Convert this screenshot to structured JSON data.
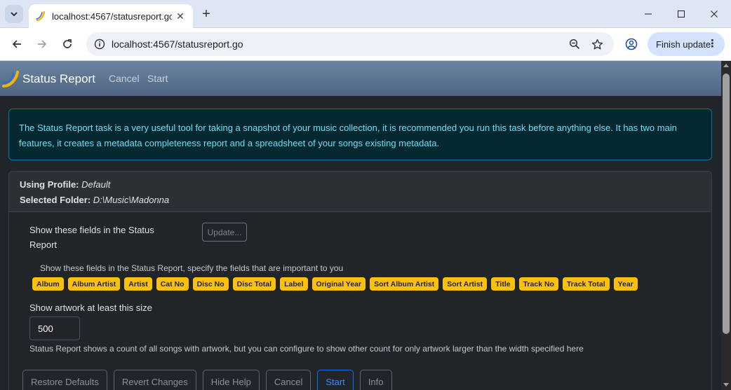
{
  "browser": {
    "tab_title": "localhost:4567/statusreport.go",
    "url": "localhost:4567/statusreport.go",
    "finish_update_label": "Finish update"
  },
  "navbar": {
    "title": "Status Report",
    "links": [
      "Cancel",
      "Start"
    ]
  },
  "alert": {
    "text": "The Status Report task is a very useful tool for taking a snapshot of your music collection, it is recommended you run this task before anything else. It has two main features, it creates a metadata completeness report and a spreadsheet of your songs existing metadata."
  },
  "profile": {
    "using_label": "Using Profile:",
    "using_value": "Default",
    "folder_label": "Selected Folder:",
    "folder_value": "D:\\Music\\Madonna"
  },
  "fields_option": {
    "label": "Show these fields in the Status Report",
    "update_button": "Update...",
    "help": "Show these fields in the Status Report, specify the fields that are important to you",
    "fields": [
      "Album",
      "Album Artist",
      "Artist",
      "Cat No",
      "Disc No",
      "Disc Total",
      "Label",
      "Original Year",
      "Sort Album Artist",
      "Sort Artist",
      "Title",
      "Track No",
      "Track Total",
      "Year"
    ]
  },
  "artwork_option": {
    "label": "Show artwork at least this size",
    "value": "500",
    "help": "Status Report shows a count of all songs with artwork, but you can configure to show other count for only artwork larger than the width specified here"
  },
  "buttons": {
    "restore_defaults": "Restore Defaults",
    "revert_changes": "Revert Changes",
    "hide_help": "Hide Help",
    "cancel": "Cancel",
    "start": "Start",
    "info": "Info"
  },
  "colors": {
    "navbar": "#5b7291",
    "alert_bg": "#032830",
    "alert_text": "#6edff6",
    "badge": "#ffc107",
    "primary": "#0d6efd"
  }
}
